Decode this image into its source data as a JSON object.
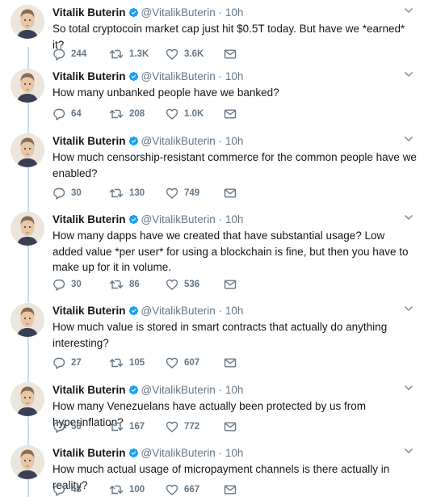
{
  "author": {
    "name": "Vitalik Buterin",
    "handle": "@VitalikButerin",
    "separator": "·",
    "verified": true
  },
  "icons": {
    "reply": "reply-icon",
    "retweet": "retweet-icon",
    "like": "heart-icon",
    "message": "envelope-icon",
    "more": "chevron-down-icon",
    "verified": "verified-badge-icon"
  },
  "colors": {
    "text": "#14171a",
    "muted": "#657786",
    "verified": "#1da1f2",
    "thread_line": "#c4dff2"
  },
  "tweets": [
    {
      "time": "10h",
      "text": "So total cryptocoin market cap just hit $0.5T today. But have we *earned* it?",
      "replies": "244",
      "retweets": "1.3K",
      "likes": "3.6K"
    },
    {
      "time": "10h",
      "text": "How many unbanked people have we banked?",
      "replies": "64",
      "retweets": "208",
      "likes": "1.0K"
    },
    {
      "time": "10h",
      "text": "How much censorship-resistant commerce for the common people have we enabled?",
      "replies": "30",
      "retweets": "130",
      "likes": "749"
    },
    {
      "time": "10h",
      "text": "How many dapps have we created that have substantial usage? Low added value *per user* for using a blockchain is fine, but then you have to make up for it in volume.",
      "replies": "30",
      "retweets": "86",
      "likes": "536"
    },
    {
      "time": "10h",
      "text": "How much value is stored in smart contracts that actually do anything interesting?",
      "replies": "27",
      "retweets": "105",
      "likes": "607"
    },
    {
      "time": "10h",
      "text": "How many Venezuelans have actually been protected by us from hyperinflation?",
      "replies": "56",
      "retweets": "167",
      "likes": "772"
    },
    {
      "time": "10h",
      "text": "How much actual usage of micropayment channels is there actually in reality?",
      "replies": "48",
      "retweets": "100",
      "likes": "667"
    }
  ]
}
